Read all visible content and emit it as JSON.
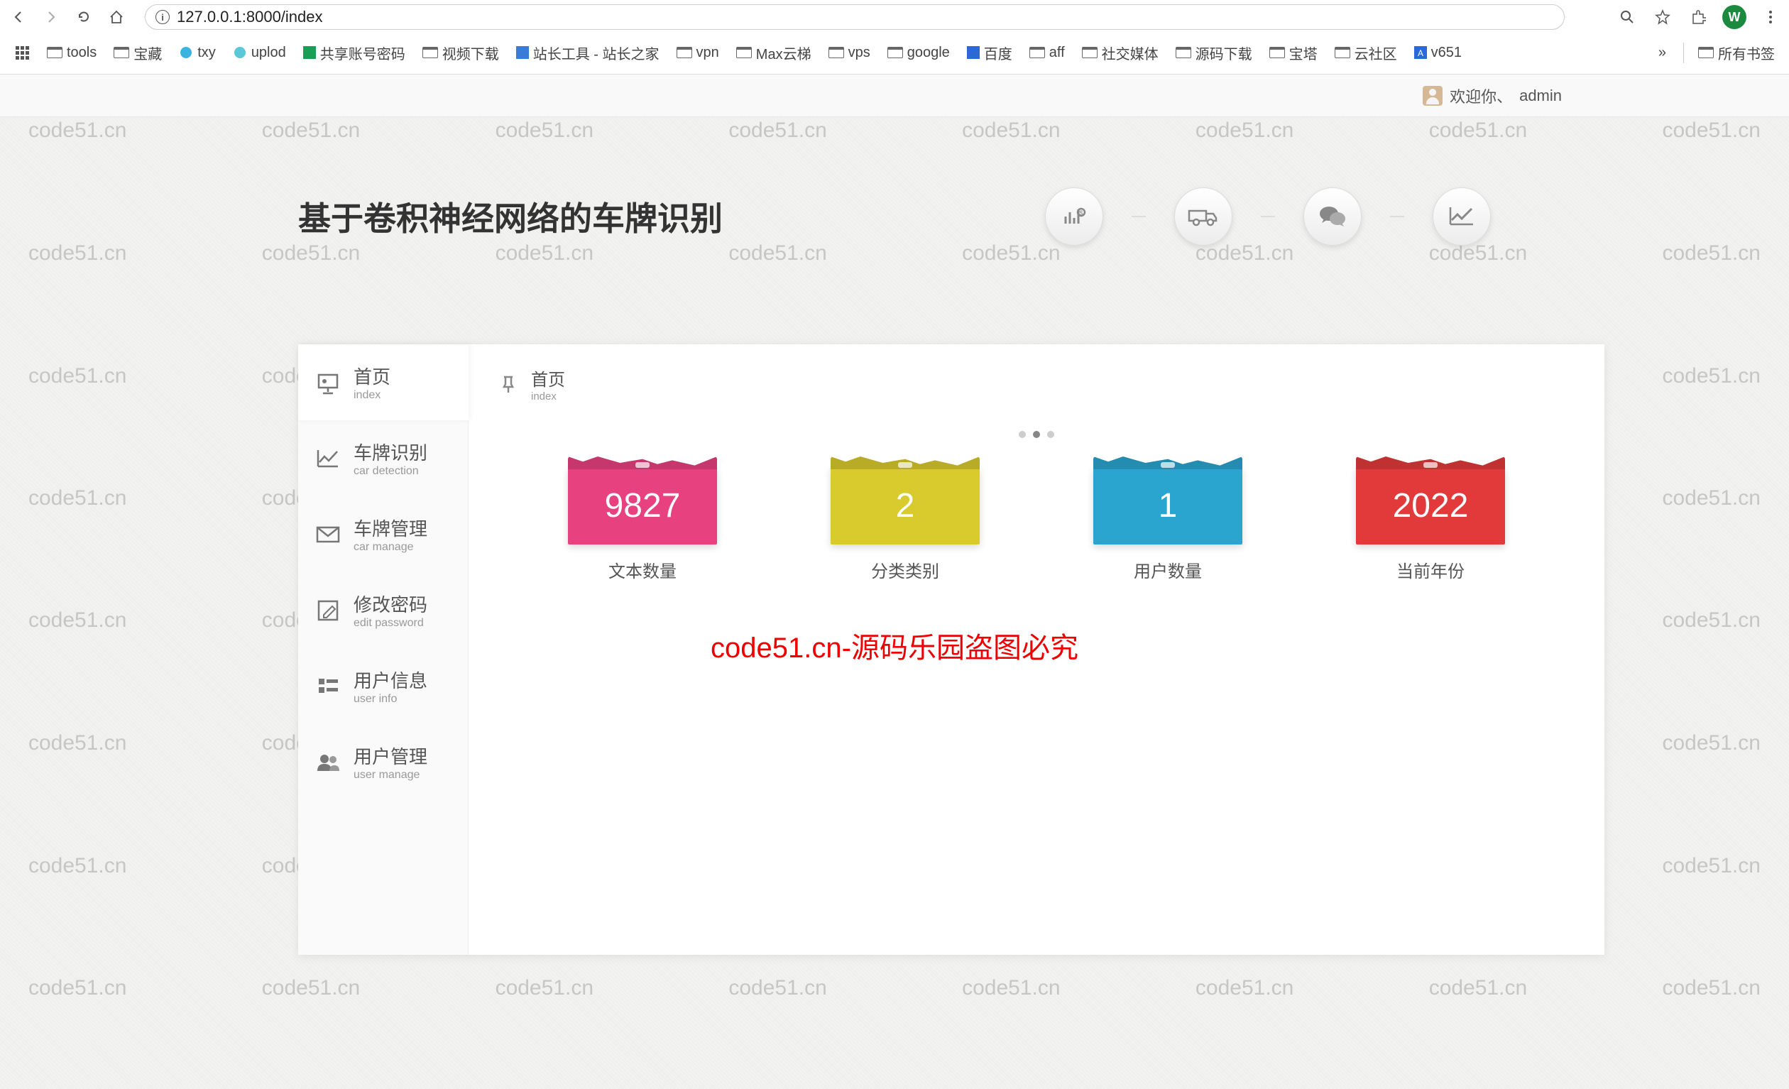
{
  "browser": {
    "url": "127.0.0.1:8000/index",
    "avatar_letter": "W",
    "bookmarks": [
      "tools",
      "宝藏",
      "txy",
      "uplod",
      "共享账号密码",
      "视频下载",
      "站长工具 - 站长之家",
      "vpn",
      "Max云梯",
      "vps",
      "google",
      "百度",
      "aff",
      "社交媒体",
      "源码下载",
      "宝塔",
      "云社区",
      "v651"
    ],
    "bookmarks_overflow": "»",
    "all_bookmarks": "所有书签"
  },
  "userbar": {
    "welcome": "欢迎你、",
    "username": "admin"
  },
  "header": {
    "title": "基于卷积神经网络的车牌识别"
  },
  "sidebar": {
    "items": [
      {
        "cn": "首页",
        "en": "index"
      },
      {
        "cn": "车牌识别",
        "en": "car detection"
      },
      {
        "cn": "车牌管理",
        "en": "car manage"
      },
      {
        "cn": "修改密码",
        "en": "edit password"
      },
      {
        "cn": "用户信息",
        "en": "user info"
      },
      {
        "cn": "用户管理",
        "en": "user manage"
      }
    ]
  },
  "breadcrumb": {
    "cn": "首页",
    "en": "index"
  },
  "stats": [
    {
      "value": "9827",
      "label": "文本数量",
      "color": "pink"
    },
    {
      "value": "2",
      "label": "分类类别",
      "color": "yellow"
    },
    {
      "value": "1",
      "label": "用户数量",
      "color": "blue"
    },
    {
      "value": "2022",
      "label": "当前年份",
      "color": "red"
    }
  ],
  "watermark_text": "code51.cn",
  "overlay_text": "code51.cn-源码乐园盗图必究"
}
